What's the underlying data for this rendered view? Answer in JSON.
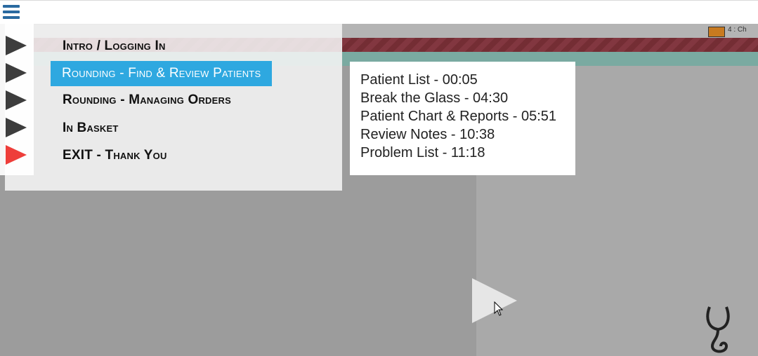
{
  "menu": {
    "items": [
      {
        "label": "Intro / Logging In",
        "active": false,
        "arrow_color": "#3d3d3d"
      },
      {
        "label": "Rounding - Find & Review Patients",
        "active": true,
        "arrow_color": "#3d3d3d"
      },
      {
        "label": "Rounding - Managing Orders",
        "active": false,
        "arrow_color": "#3d3d3d"
      },
      {
        "label": "In Basket",
        "active": false,
        "arrow_color": "#3d3d3d"
      },
      {
        "label": "EXIT - Thank You",
        "active": false,
        "arrow_color": "#ee3e3a"
      }
    ]
  },
  "chapters": [
    {
      "label": "Patient List - 00:05"
    },
    {
      "label": "Break the Glass - 04:30"
    },
    {
      "label": "Patient Chart & Reports - 05:51"
    },
    {
      "label": "Review Notes - 10:38"
    },
    {
      "label": "Problem List - 11:18"
    }
  ],
  "video": {
    "badge_text": "4 : Ch"
  },
  "colors": {
    "accent": "#2ea8e0",
    "hamburger": "#2a6aa0",
    "exit_arrow": "#ee3e3a"
  },
  "icons": [
    "hamburger-menu-icon",
    "play-arrow-icon",
    "play-button-icon",
    "mouse-cursor-icon",
    "stethoscope-icon"
  ]
}
